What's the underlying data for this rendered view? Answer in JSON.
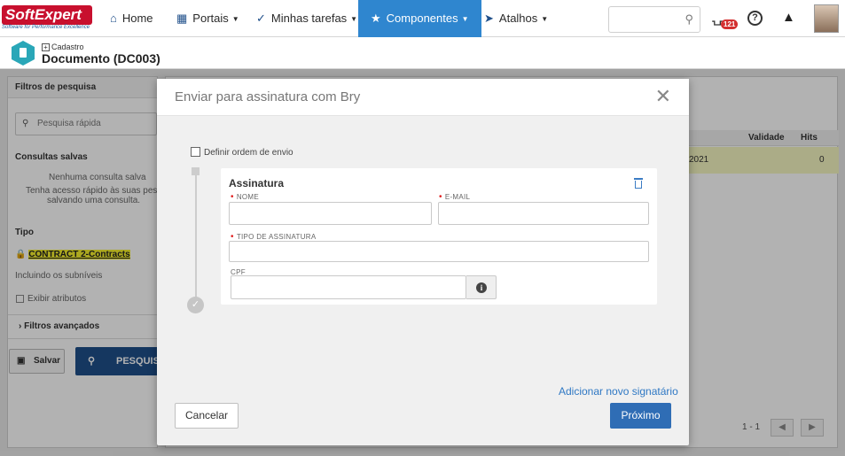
{
  "brand": {
    "logo_text": "SoftExpert",
    "tagline": "Software for Performance Excellence"
  },
  "nav": {
    "items": [
      {
        "label": "Home"
      },
      {
        "label": "Portais"
      },
      {
        "label": "Minhas tarefas"
      },
      {
        "label": "Componentes"
      },
      {
        "label": "Atalhos"
      }
    ],
    "notifications_count": "121"
  },
  "subheader": {
    "breadcrumb": "Cadastro",
    "title": "Documento (DC003)"
  },
  "left_panel": {
    "title": "Filtros de pesquisa",
    "quick_search_placeholder": "Pesquisa rápida",
    "saved_title": "Consultas salvas",
    "no_saved": "Nenhuma consulta salva",
    "saved_hint_1": "Tenha acesso rápido às suas pesq",
    "saved_hint_2": "salvando uma consulta.",
    "type_title": "Tipo",
    "contract": "CONTRACT 2-Contracts",
    "include_sub": "Incluindo os subníveis",
    "show_attrs": "Exibir atributos",
    "advanced": "Filtros avançados",
    "save_label": "Salvar",
    "search_label": "PESQUIS"
  },
  "grid": {
    "columns": [
      "Validade",
      "Hits"
    ],
    "row": {
      "date_fragment": "2021",
      "hits": "0"
    },
    "pager": "1 - 1"
  },
  "modal": {
    "title": "Enviar para assinatura com Bry",
    "order_checkbox_label": "Definir ordem de envio",
    "card_title": "Assinatura",
    "fields": {
      "name_label": "NOME",
      "email_label": "E-MAIL",
      "type_label": "TIPO DE ASSINATURA",
      "cpf_label": "CPF"
    },
    "add_signer": "Adicionar novo signatário",
    "cancel": "Cancelar",
    "next": "Próximo"
  }
}
